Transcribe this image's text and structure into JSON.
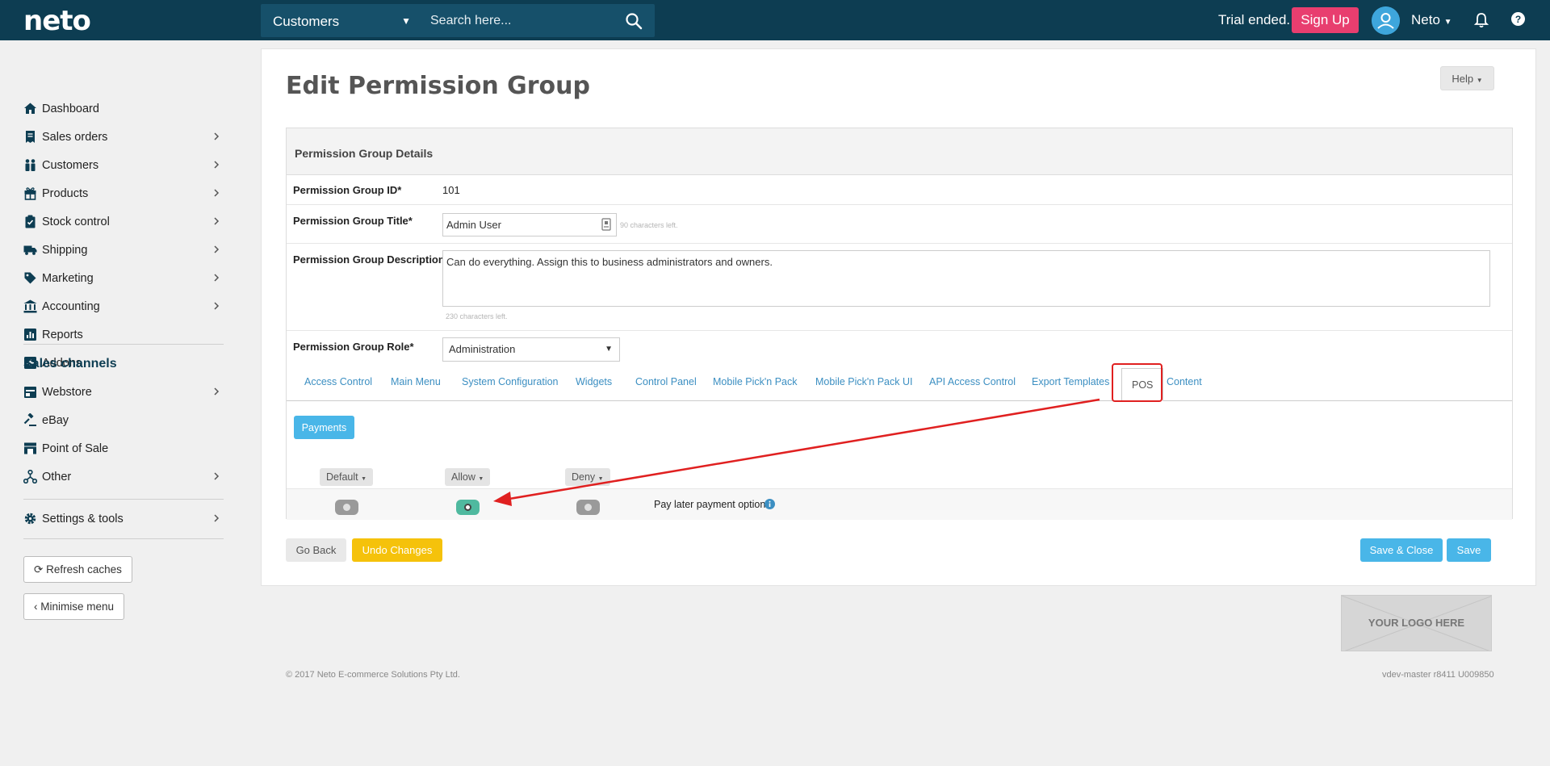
{
  "topbar": {
    "logo": "neto",
    "search_scope": "Customers",
    "search_placeholder": "Search here...",
    "trial_text": "Trial ended.",
    "signup_label": "Sign Up",
    "user_name": "Neto"
  },
  "sidebar": {
    "items": [
      {
        "label": "Dashboard",
        "icon": "home-icon",
        "chevron": false
      },
      {
        "label": "Sales orders",
        "icon": "receipt-icon",
        "chevron": true
      },
      {
        "label": "Customers",
        "icon": "people-icon",
        "chevron": true
      },
      {
        "label": "Products",
        "icon": "gift-icon",
        "chevron": true
      },
      {
        "label": "Stock control",
        "icon": "clipboard-icon",
        "chevron": true
      },
      {
        "label": "Shipping",
        "icon": "truck-icon",
        "chevron": true
      },
      {
        "label": "Marketing",
        "icon": "tag-icon",
        "chevron": true
      },
      {
        "label": "Accounting",
        "icon": "bank-icon",
        "chevron": true
      },
      {
        "label": "Reports",
        "icon": "chart-icon",
        "chevron": false
      },
      {
        "label": "Addons",
        "icon": "plus-square-icon",
        "chevron": false
      }
    ],
    "sales_channels_title": "Sales channels",
    "channels": [
      {
        "label": "Webstore",
        "icon": "store-icon",
        "chevron": true
      },
      {
        "label": "eBay",
        "icon": "gavel-icon",
        "chevron": false
      },
      {
        "label": "Point of Sale",
        "icon": "register-icon",
        "chevron": false
      },
      {
        "label": "Other",
        "icon": "network-icon",
        "chevron": true
      }
    ],
    "settings_label": "Settings & tools",
    "refresh_label": "Refresh caches",
    "minimise_label": "Minimise menu"
  },
  "main": {
    "title": "Edit Permission Group",
    "help_label": "Help",
    "details_title": "Permission Group Details",
    "id_label": "Permission Group ID*",
    "id_value": "101",
    "title_label": "Permission Group Title*",
    "title_value": "Admin User",
    "title_hint": "90 characters left.",
    "description_label": "Permission Group Description",
    "description_value": "Can do everything. Assign this to business administrators and owners.",
    "description_hint": "230 characters left.",
    "role_label": "Permission Group Role*",
    "role_value": "Administration",
    "tabs": [
      "Access Control",
      "Main Menu",
      "System Configuration",
      "Widgets",
      "Control Panel",
      "Mobile Pick'n Pack",
      "Mobile Pick'n Pack UI",
      "API Access Control",
      "Export Templates",
      "POS",
      "Content"
    ],
    "active_tab": "POS",
    "payments_label": "Payments",
    "columns": [
      "Default",
      "Allow",
      "Deny"
    ],
    "permission_label": "Pay later payment option",
    "go_back_label": "Go Back",
    "undo_label": "Undo Changes",
    "save_close_label": "Save & Close",
    "save_label": "Save"
  },
  "footer": {
    "logo_placeholder": "YOUR LOGO HERE",
    "copyright": "© 2017 Neto E-commerce Solutions Pty Ltd.",
    "version": "vdev-master r8411 U009850"
  },
  "colors": {
    "topbar": "#0d3d52",
    "accent": "#49b6e8",
    "signup": "#e83e6f",
    "undo": "#f5c20b",
    "allow_on": "#4fb99f",
    "annotation": "#e02020"
  }
}
